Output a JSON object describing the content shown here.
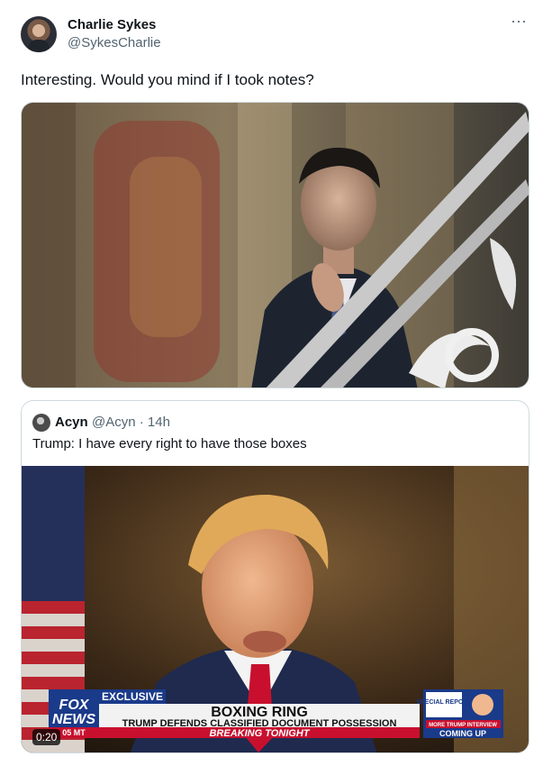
{
  "author": {
    "name": "Charlie Sykes",
    "handle": "@SykesCharlie"
  },
  "tweet": {
    "text": "Interesting. Would you mind if I took notes?",
    "more_icon": "ellipsis-icon"
  },
  "quoted": {
    "name": "Acyn",
    "handle_time": "@Acyn · 14h",
    "text": "Trump: I have every right to have those boxes",
    "video": {
      "duration": "0:20",
      "chyron": {
        "tag": "EXCLUSIVE",
        "headline": "BOXING RING",
        "subhead": "TRUMP DEFENDS CLASSIFIED DOCUMENT POSSESSION",
        "ticker": "BREAKING TONIGHT",
        "logo_top": "FOX",
        "logo_bottom": "NEWS",
        "logo_time": "05 MT",
        "promo_title": "SPECIAL REPORT",
        "promo_line1": "MORE TRUMP INTERVIEW",
        "promo_line2": "COMING UP"
      }
    }
  },
  "colors": {
    "text": "#0f1419",
    "muted": "#536471",
    "border": "#cfd9de",
    "fox_blue": "#1a3a8a",
    "fox_red": "#c8102e"
  }
}
